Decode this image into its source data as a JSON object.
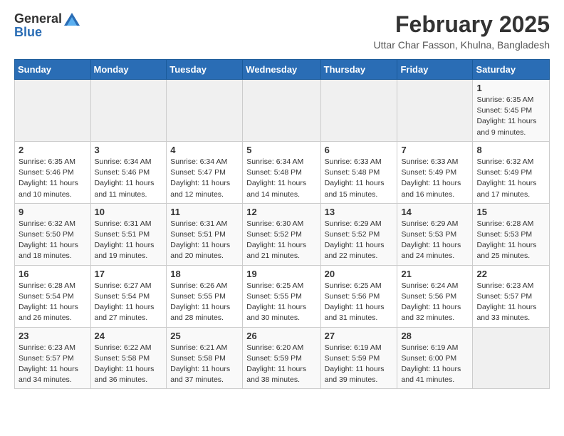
{
  "header": {
    "logo_general": "General",
    "logo_blue": "Blue",
    "month_title": "February 2025",
    "location": "Uttar Char Fasson, Khulna, Bangladesh"
  },
  "weekdays": [
    "Sunday",
    "Monday",
    "Tuesday",
    "Wednesday",
    "Thursday",
    "Friday",
    "Saturday"
  ],
  "weeks": [
    [
      {
        "day": "",
        "info": ""
      },
      {
        "day": "",
        "info": ""
      },
      {
        "day": "",
        "info": ""
      },
      {
        "day": "",
        "info": ""
      },
      {
        "day": "",
        "info": ""
      },
      {
        "day": "",
        "info": ""
      },
      {
        "day": "1",
        "info": "Sunrise: 6:35 AM\nSunset: 5:45 PM\nDaylight: 11 hours and 9 minutes."
      }
    ],
    [
      {
        "day": "2",
        "info": "Sunrise: 6:35 AM\nSunset: 5:46 PM\nDaylight: 11 hours and 10 minutes."
      },
      {
        "day": "3",
        "info": "Sunrise: 6:34 AM\nSunset: 5:46 PM\nDaylight: 11 hours and 11 minutes."
      },
      {
        "day": "4",
        "info": "Sunrise: 6:34 AM\nSunset: 5:47 PM\nDaylight: 11 hours and 12 minutes."
      },
      {
        "day": "5",
        "info": "Sunrise: 6:34 AM\nSunset: 5:48 PM\nDaylight: 11 hours and 14 minutes."
      },
      {
        "day": "6",
        "info": "Sunrise: 6:33 AM\nSunset: 5:48 PM\nDaylight: 11 hours and 15 minutes."
      },
      {
        "day": "7",
        "info": "Sunrise: 6:33 AM\nSunset: 5:49 PM\nDaylight: 11 hours and 16 minutes."
      },
      {
        "day": "8",
        "info": "Sunrise: 6:32 AM\nSunset: 5:49 PM\nDaylight: 11 hours and 17 minutes."
      }
    ],
    [
      {
        "day": "9",
        "info": "Sunrise: 6:32 AM\nSunset: 5:50 PM\nDaylight: 11 hours and 18 minutes."
      },
      {
        "day": "10",
        "info": "Sunrise: 6:31 AM\nSunset: 5:51 PM\nDaylight: 11 hours and 19 minutes."
      },
      {
        "day": "11",
        "info": "Sunrise: 6:31 AM\nSunset: 5:51 PM\nDaylight: 11 hours and 20 minutes."
      },
      {
        "day": "12",
        "info": "Sunrise: 6:30 AM\nSunset: 5:52 PM\nDaylight: 11 hours and 21 minutes."
      },
      {
        "day": "13",
        "info": "Sunrise: 6:29 AM\nSunset: 5:52 PM\nDaylight: 11 hours and 22 minutes."
      },
      {
        "day": "14",
        "info": "Sunrise: 6:29 AM\nSunset: 5:53 PM\nDaylight: 11 hours and 24 minutes."
      },
      {
        "day": "15",
        "info": "Sunrise: 6:28 AM\nSunset: 5:53 PM\nDaylight: 11 hours and 25 minutes."
      }
    ],
    [
      {
        "day": "16",
        "info": "Sunrise: 6:28 AM\nSunset: 5:54 PM\nDaylight: 11 hours and 26 minutes."
      },
      {
        "day": "17",
        "info": "Sunrise: 6:27 AM\nSunset: 5:54 PM\nDaylight: 11 hours and 27 minutes."
      },
      {
        "day": "18",
        "info": "Sunrise: 6:26 AM\nSunset: 5:55 PM\nDaylight: 11 hours and 28 minutes."
      },
      {
        "day": "19",
        "info": "Sunrise: 6:25 AM\nSunset: 5:55 PM\nDaylight: 11 hours and 30 minutes."
      },
      {
        "day": "20",
        "info": "Sunrise: 6:25 AM\nSunset: 5:56 PM\nDaylight: 11 hours and 31 minutes."
      },
      {
        "day": "21",
        "info": "Sunrise: 6:24 AM\nSunset: 5:56 PM\nDaylight: 11 hours and 32 minutes."
      },
      {
        "day": "22",
        "info": "Sunrise: 6:23 AM\nSunset: 5:57 PM\nDaylight: 11 hours and 33 minutes."
      }
    ],
    [
      {
        "day": "23",
        "info": "Sunrise: 6:23 AM\nSunset: 5:57 PM\nDaylight: 11 hours and 34 minutes."
      },
      {
        "day": "24",
        "info": "Sunrise: 6:22 AM\nSunset: 5:58 PM\nDaylight: 11 hours and 36 minutes."
      },
      {
        "day": "25",
        "info": "Sunrise: 6:21 AM\nSunset: 5:58 PM\nDaylight: 11 hours and 37 minutes."
      },
      {
        "day": "26",
        "info": "Sunrise: 6:20 AM\nSunset: 5:59 PM\nDaylight: 11 hours and 38 minutes."
      },
      {
        "day": "27",
        "info": "Sunrise: 6:19 AM\nSunset: 5:59 PM\nDaylight: 11 hours and 39 minutes."
      },
      {
        "day": "28",
        "info": "Sunrise: 6:19 AM\nSunset: 6:00 PM\nDaylight: 11 hours and 41 minutes."
      },
      {
        "day": "",
        "info": ""
      }
    ]
  ]
}
